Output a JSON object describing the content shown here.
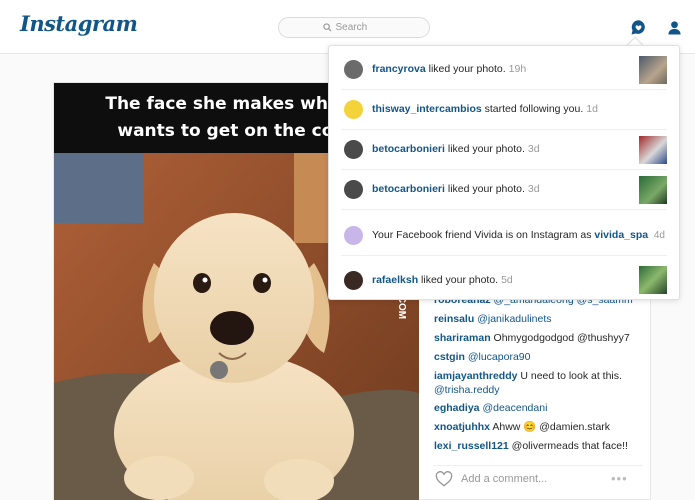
{
  "header": {
    "logo": "Instagram",
    "search_placeholder": "Search",
    "accent_color": "#125688"
  },
  "post": {
    "photo_caption": "The face she makes when s\nwants to get on the couc",
    "photo_watermark": ".COM",
    "comments": [
      {
        "user": "roboreanaz",
        "text": "@_amandaleong @s_saamm"
      },
      {
        "user": "reinsalu",
        "text": "@janikadulinets"
      },
      {
        "user": "shariraman",
        "text": "Ohmygodgodgod @thushyy7"
      },
      {
        "user": "cstgin",
        "text": "@lucapora90"
      },
      {
        "user": "iamjayanthreddy",
        "text": "U need to look at this.",
        "cont": "@trisha.reddy"
      },
      {
        "user": "eghadiya",
        "text": "@deacendani"
      },
      {
        "user": "xnoatjuhhx",
        "text": "Ahww 😊 @damien.stark"
      },
      {
        "user": "lexi_russell121",
        "text": "@olivermeads that face!!"
      }
    ],
    "add_comment_placeholder": "Add a comment...",
    "more_label": "•••"
  },
  "notifications": [
    {
      "user": "francyrova",
      "text": " liked your photo.",
      "time": "19h",
      "avatar_color": "#6b6b6b",
      "thumb": "street"
    },
    {
      "user": "thisway_intercambios",
      "text": " started following you.",
      "time": "1d",
      "avatar_color": "#f4d33a",
      "thumb": ""
    },
    {
      "user": "betocarbonieri",
      "text": " liked your photo.",
      "time": "3d",
      "avatar_color": "#4a4a4a",
      "thumb": "red"
    },
    {
      "user": "betocarbonieri",
      "text": " liked your photo.",
      "time": "3d",
      "avatar_color": "#4a4a4a",
      "thumb": "green"
    },
    {
      "prefix": "Your Facebook friend Vivida is on Instagram as ",
      "user": "vivida_spa",
      "time": "4d",
      "avatar_color": "#c9b6e8",
      "thumb": ""
    },
    {
      "user": "rafaelksh",
      "text": " liked your photo.",
      "time": "5d",
      "avatar_color": "#3b2a24",
      "thumb": "green2"
    }
  ]
}
